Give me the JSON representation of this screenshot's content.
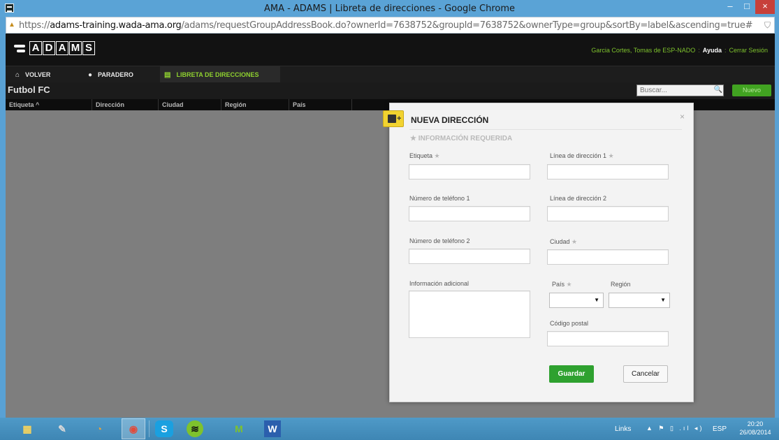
{
  "window": {
    "title": "AMA - ADAMS | Libreta de direcciones - Google Chrome",
    "minimize": "–",
    "maximize": "□",
    "close": "×"
  },
  "address_bar": {
    "url_prefix": "https://",
    "url_host": "adams-training.wada-ama.org",
    "url_path": "/adams/requestGroupAddressBook.do?ownerId=7638752&groupId=7638752&ownerType=group&sortBy=label&ascending=true#"
  },
  "app": {
    "logo_letters": [
      "A",
      "D",
      "A",
      "M",
      "S"
    ],
    "user": "Garcia Cortes, Tomas de ESP-NADO",
    "help": "Ayuda",
    "logout": "Cerrar Sesión",
    "separator": ":"
  },
  "nav": [
    {
      "label": "VOLVER",
      "icon": "home-icon",
      "glyph": "⌂"
    },
    {
      "label": "PARADERO",
      "icon": "location-pin-icon",
      "glyph": "●"
    },
    {
      "label": "LIBRETA DE DIRECCIONES",
      "icon": "address-book-icon",
      "glyph": "▤"
    }
  ],
  "list": {
    "group_name": "Futbol FC",
    "search_placeholder": "Buscar...",
    "search_icon_glyph": "🔍",
    "new_button": "Nuevo",
    "columns": [
      "Etiqueta ^",
      "Dirección",
      "Ciudad",
      "Región",
      "País"
    ]
  },
  "modal": {
    "title": "NUEVA DIRECCIÓN",
    "close": "×",
    "required_note": "★ INFORMACIÓN REQUERIDA",
    "required_star": "★",
    "fields": {
      "etiqueta": "Etiqueta",
      "linea1": "Línea de dirección 1",
      "telefono1": "Número de teléfono 1",
      "linea2": "Línea de dirección 2",
      "telefono2": "Número de teléfono 2",
      "ciudad": "Ciudad",
      "info": "Información adicional",
      "pais": "País",
      "region": "Región",
      "codigo_postal": "Código postal"
    },
    "save": "Guardar",
    "cancel": "Cancelar"
  },
  "taskbar": {
    "apps": [
      {
        "name": "file-explorer",
        "glyph": "▦"
      },
      {
        "name": "notepad",
        "glyph": "✎"
      },
      {
        "name": "picasa",
        "glyph": "◔"
      },
      {
        "name": "chrome",
        "glyph": "◉"
      },
      {
        "name": "skype",
        "glyph": "S"
      },
      {
        "name": "spotify",
        "glyph": "≋"
      },
      {
        "name": "movistar",
        "glyph": "M"
      },
      {
        "name": "word",
        "glyph": "W"
      }
    ],
    "links": "Links",
    "tray_icons": "▲ ⚑ ▯ .ıl ◂)",
    "language": "ESP",
    "time": "20:20",
    "date": "26/08/2014"
  },
  "colors": {
    "accent_green": "#41a321",
    "save_green": "#2ea12f",
    "nav_active": "#8fd12f",
    "modal_icon_yellow": "#f2d330"
  }
}
